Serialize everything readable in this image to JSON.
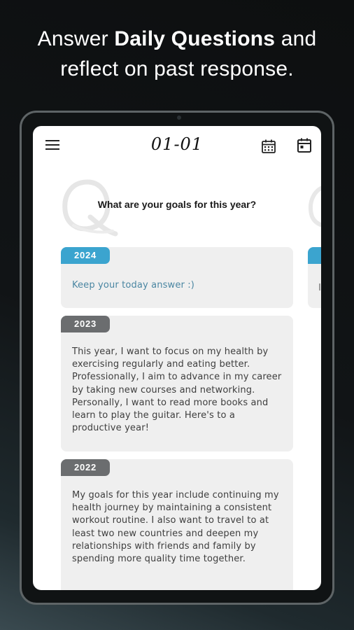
{
  "promo": {
    "line1_prefix": "Answer ",
    "line1_bold": "Daily Questions",
    "line1_suffix": " and",
    "line2": "reflect on past response."
  },
  "app": {
    "date_title": "01-01",
    "icons": {
      "menu": "menu-icon",
      "calendar_grid": "calendar-grid-icon",
      "calendar_day": "calendar-day-icon",
      "watermark": "q-watermark-icon"
    },
    "question": "What are your goals for this year?",
    "entries": [
      {
        "year": "2024",
        "text": "Keep your today answer :)",
        "is_current": true
      },
      {
        "year": "2023",
        "text": "This year, I want to focus on my health by exercising regularly and eating better. Professionally, I aim to advance in my career by taking new courses and networking. Personally, I want to read more books and learn to play the guitar. Here's to a productive year!",
        "is_current": false
      },
      {
        "year": "2022",
        "text": "My goals for this year include continuing my health journey by maintaining a consistent workout routine. I also want to travel to at least two new countries and deepen my relationships with friends and family by spending more quality time together.",
        "is_current": false
      }
    ]
  },
  "colors": {
    "accent_blue": "#3ba4cf",
    "past_tab": "#6b6d6f",
    "card_bg": "#efefef",
    "placeholder_text": "#4a86a2"
  }
}
